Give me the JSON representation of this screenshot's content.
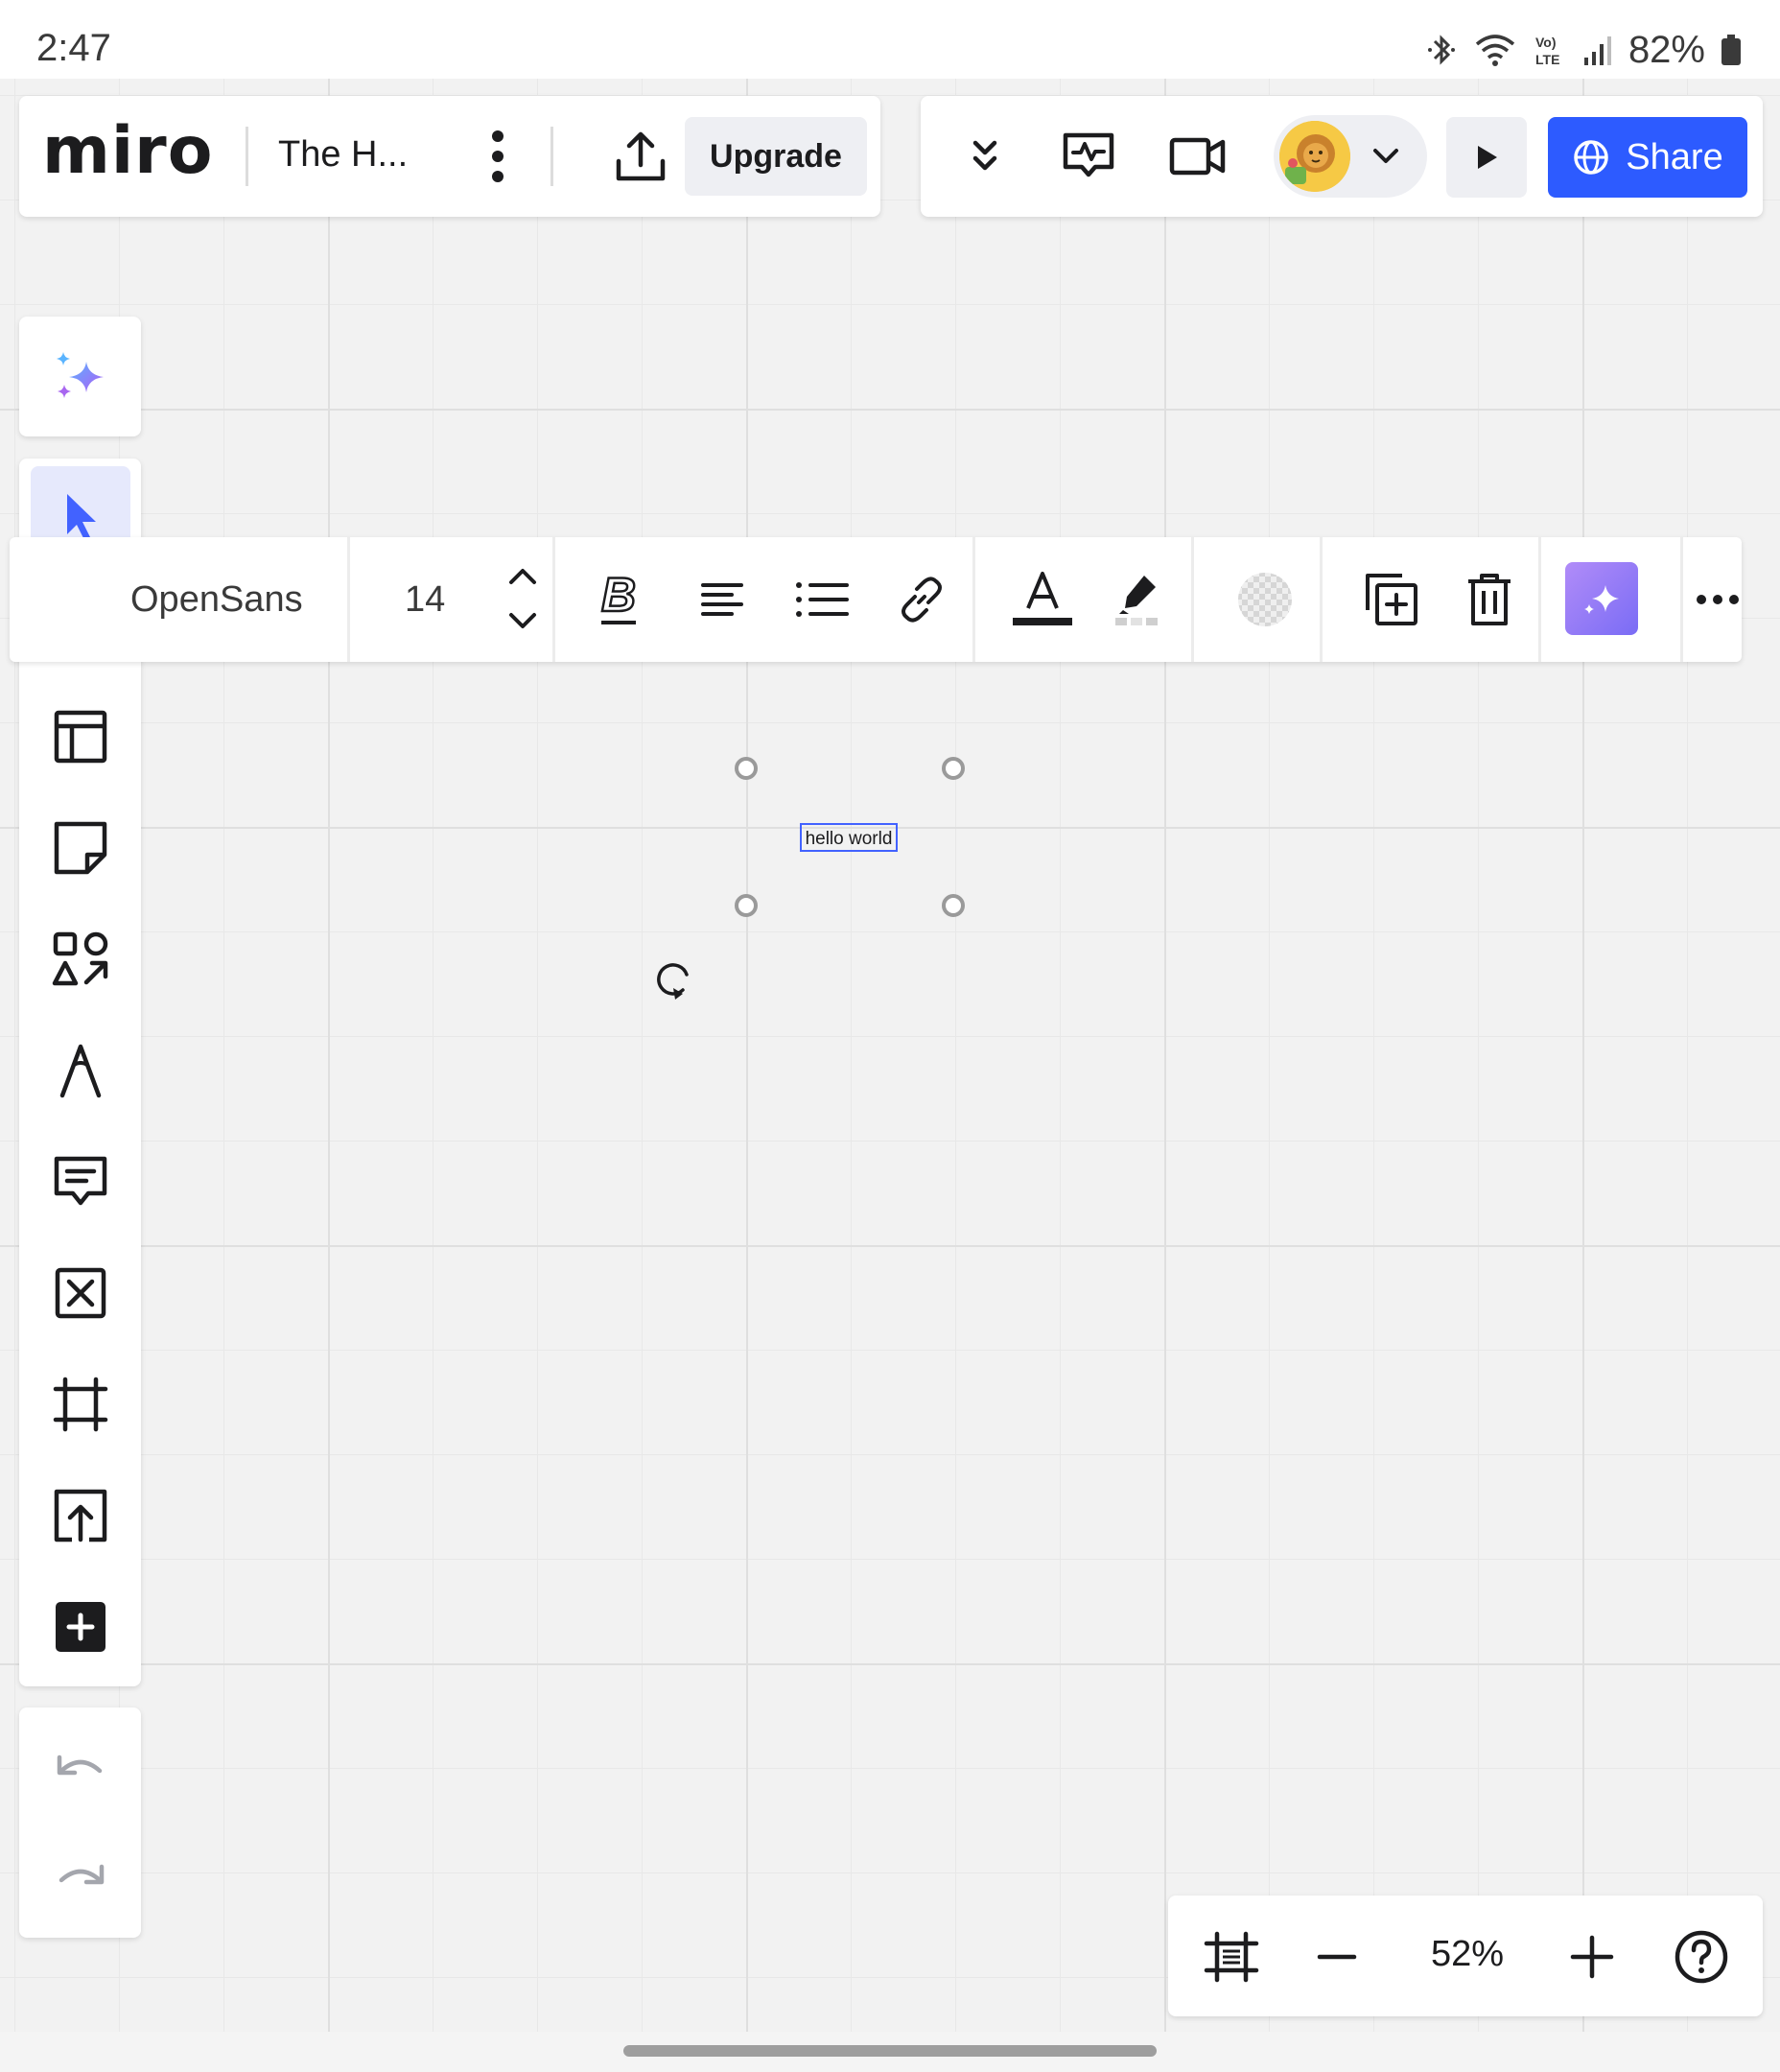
{
  "status_bar": {
    "time": "2:47",
    "battery": "82%",
    "icons": [
      "bluetooth-icon",
      "wifi-icon",
      "volte-icon",
      "signal-icon",
      "battery-icon"
    ]
  },
  "header": {
    "logo": "miro",
    "board_title": "The H...",
    "upgrade_label": "Upgrade",
    "share_label": "Share",
    "accent_color": "#2d5bff"
  },
  "context_toolbar": {
    "font_family": "OpenSans",
    "font_size": "14"
  },
  "canvas": {
    "text_item": "hello world"
  },
  "zoom": {
    "level": "52%"
  },
  "left_toolbar": {
    "tools": [
      "select",
      "text",
      "templates",
      "sticky-note",
      "shapes",
      "pen",
      "comment",
      "frame-cross",
      "frame",
      "upload",
      "more"
    ]
  }
}
